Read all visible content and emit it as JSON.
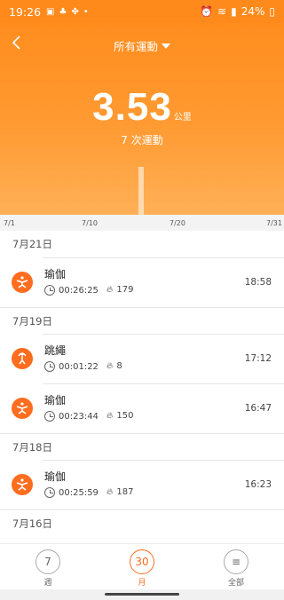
{
  "status": {
    "time": "19:26",
    "battery": "24%"
  },
  "header": {
    "filter_label": "所有運動"
  },
  "summary": {
    "distance": "3.53",
    "unit": "公里",
    "count_text": "7 次運動"
  },
  "axis": {
    "labels": [
      "7/1",
      "7/10",
      "7/20",
      "7/31"
    ]
  },
  "list": {
    "groups": [
      {
        "date": "7月21日",
        "items": [
          {
            "name": "瑜伽",
            "duration": "00:26:25",
            "calories": "179",
            "time": "18:58"
          }
        ]
      },
      {
        "date": "7月19日",
        "items": [
          {
            "name": "跳繩",
            "duration": "00:01:22",
            "calories": "8",
            "time": "17:12"
          },
          {
            "name": "瑜伽",
            "duration": "00:23:44",
            "calories": "150",
            "time": "16:47"
          }
        ]
      },
      {
        "date": "7月18日",
        "items": [
          {
            "name": "瑜伽",
            "duration": "00:25:59",
            "calories": "187",
            "time": "16:23"
          }
        ]
      },
      {
        "date": "7月16日",
        "items": []
      }
    ]
  },
  "tabs": [
    {
      "number": "7",
      "label": "週"
    },
    {
      "number": "30",
      "label": "月"
    },
    {
      "number": "≡",
      "label": "全部"
    }
  ],
  "colors": {
    "accent": "#ff6d1f",
    "header": "#ff8d1e"
  }
}
